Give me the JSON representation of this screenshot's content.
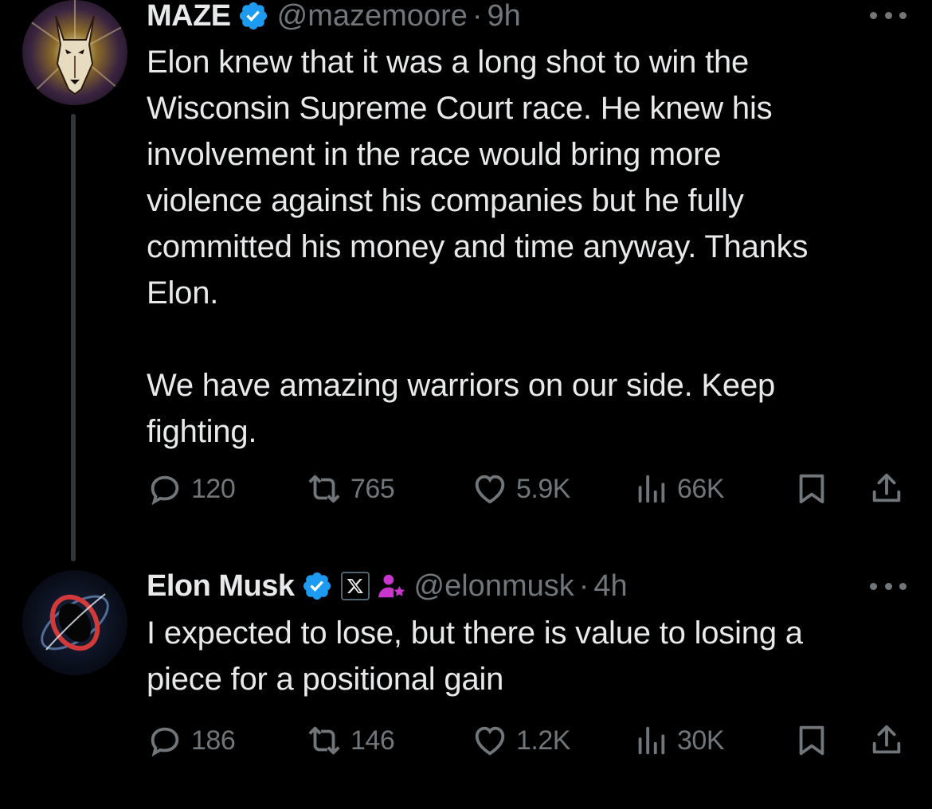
{
  "tweets": [
    {
      "name": "MAZE",
      "handle": "@mazemoore",
      "separator": "·",
      "time": "9h",
      "text": "Elon knew that it was a long shot to win the\nWisconsin Supreme Court race. He knew his\ninvolvement in the race would bring more\nviolence against his companies but he fully\ncommitted his money and time anyway. Thanks\nElon.\n\nWe have amazing warriors on our side. Keep\nfighting.",
      "replies": "120",
      "reposts": "765",
      "likes": "5.9K",
      "views": "66K",
      "avatar_icon": "doberman-avatar-icon"
    },
    {
      "name": "Elon Musk",
      "handle": "@elonmusk",
      "separator": "·",
      "time": "4h",
      "text": "I expected to lose, but there is value to losing a\npiece for a positional gain",
      "replies": "186",
      "reposts": "146",
      "likes": "1.2K",
      "views": "30K",
      "avatar_icon": "black-hole-avatar-icon",
      "affiliate_badge": "X",
      "extra_badge_icon": "government-person-icon"
    }
  ],
  "colors": {
    "background": "#000000",
    "text": "#e7e9ea",
    "muted": "#71767b",
    "verified": "#1d9bf0",
    "badge_purple": "#c936cc"
  }
}
